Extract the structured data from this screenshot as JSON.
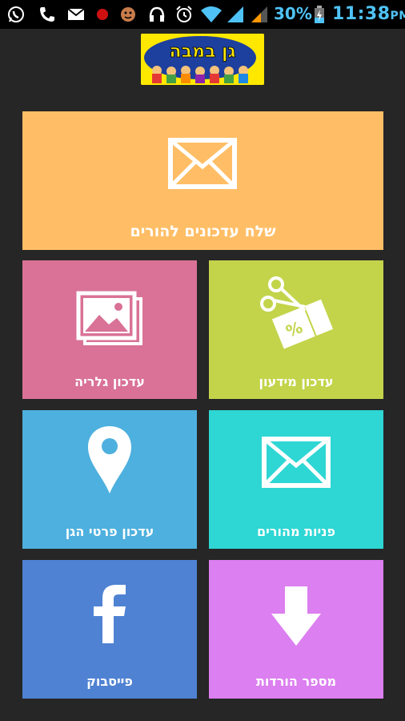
{
  "status_bar": {
    "battery_percent": "30%",
    "time": "11:38",
    "ampm": "PM"
  },
  "logo": {
    "text": "גן במבה"
  },
  "tiles": {
    "send_updates": {
      "label": "שלח עדכונים להורים",
      "color": "#ffbe66",
      "icon": "mail-icon"
    },
    "info_update": {
      "label": "עדכון מידעון",
      "color": "#c3d44b",
      "icon": "scissors-coupon-icon"
    },
    "gallery_update": {
      "label": "עדכון גלריה",
      "color": "#d97296",
      "icon": "gallery-icon"
    },
    "parents_inquiries": {
      "label": "פניות מהורים",
      "color": "#2ed6d4",
      "icon": "mail-icon"
    },
    "kindergarten_details": {
      "label": "עדכון פרטי הגן",
      "color": "#4eb0de",
      "icon": "location-pin-icon"
    },
    "downloads": {
      "label": "מספר הורדות",
      "color": "#dc7ff0",
      "icon": "download-arrow-icon"
    },
    "facebook": {
      "label": "פייסבוק",
      "color": "#4f82d2",
      "icon": "facebook-icon"
    }
  }
}
